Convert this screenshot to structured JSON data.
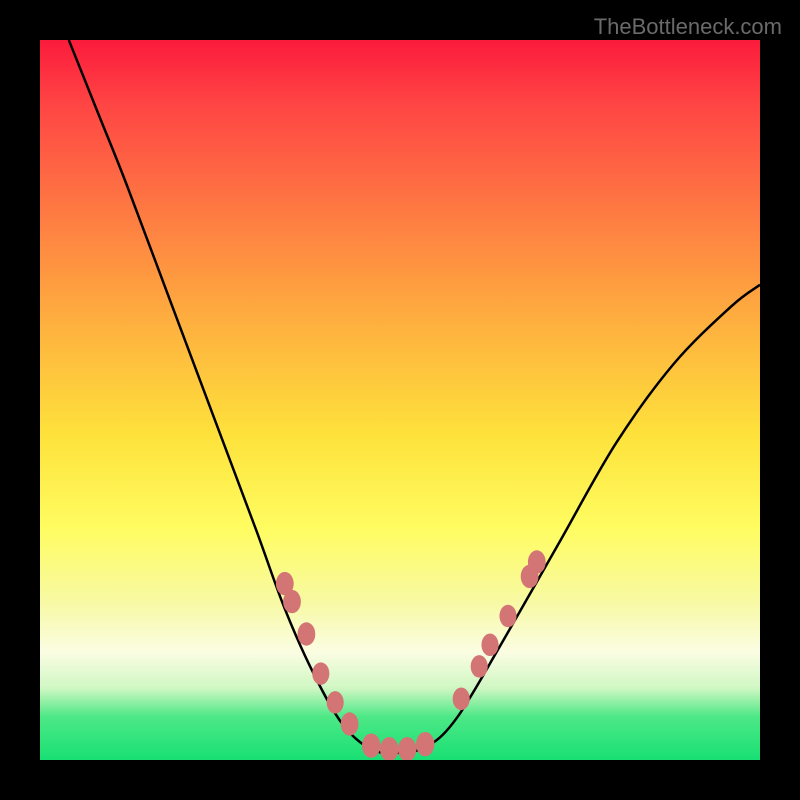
{
  "watermark": "TheBottleneck.com",
  "chart_data": {
    "type": "line",
    "title": "",
    "xlabel": "",
    "ylabel": "",
    "xlim": [
      0,
      100
    ],
    "ylim": [
      0,
      100
    ],
    "curve_points": [
      {
        "x": 4,
        "y": 100
      },
      {
        "x": 8,
        "y": 90
      },
      {
        "x": 12,
        "y": 80
      },
      {
        "x": 18,
        "y": 64
      },
      {
        "x": 24,
        "y": 48
      },
      {
        "x": 30,
        "y": 32
      },
      {
        "x": 34,
        "y": 21
      },
      {
        "x": 38,
        "y": 12
      },
      {
        "x": 42,
        "y": 5
      },
      {
        "x": 46,
        "y": 1.5
      },
      {
        "x": 50,
        "y": 1
      },
      {
        "x": 54,
        "y": 2
      },
      {
        "x": 58,
        "y": 6
      },
      {
        "x": 64,
        "y": 16
      },
      {
        "x": 72,
        "y": 30
      },
      {
        "x": 80,
        "y": 44
      },
      {
        "x": 88,
        "y": 55
      },
      {
        "x": 96,
        "y": 63
      },
      {
        "x": 100,
        "y": 66
      }
    ],
    "markers": [
      {
        "x": 34,
        "y": 24.5,
        "r": 1.3
      },
      {
        "x": 35,
        "y": 22,
        "r": 1.3
      },
      {
        "x": 37,
        "y": 17.5,
        "r": 1.3
      },
      {
        "x": 39,
        "y": 12,
        "r": 1.25
      },
      {
        "x": 41,
        "y": 8,
        "r": 1.25
      },
      {
        "x": 43,
        "y": 5,
        "r": 1.3
      },
      {
        "x": 46,
        "y": 2,
        "r": 1.35
      },
      {
        "x": 48.5,
        "y": 1.5,
        "r": 1.35
      },
      {
        "x": 51,
        "y": 1.5,
        "r": 1.35
      },
      {
        "x": 53.5,
        "y": 2.2,
        "r": 1.35
      },
      {
        "x": 58.5,
        "y": 8.5,
        "r": 1.25
      },
      {
        "x": 61,
        "y": 13,
        "r": 1.25
      },
      {
        "x": 62.5,
        "y": 16,
        "r": 1.25
      },
      {
        "x": 65,
        "y": 20,
        "r": 1.25
      },
      {
        "x": 68,
        "y": 25.5,
        "r": 1.3
      },
      {
        "x": 69,
        "y": 27.5,
        "r": 1.3
      }
    ],
    "gradient_stops": [
      {
        "pos": 0,
        "color": "#fb1b3c"
      },
      {
        "pos": 25,
        "color": "#fe7e42"
      },
      {
        "pos": 55,
        "color": "#fee23b"
      },
      {
        "pos": 85,
        "color": "#fbfde3"
      },
      {
        "pos": 100,
        "color": "#18e074"
      }
    ],
    "marker_color": "#d47575",
    "curve_color": "#000000"
  }
}
